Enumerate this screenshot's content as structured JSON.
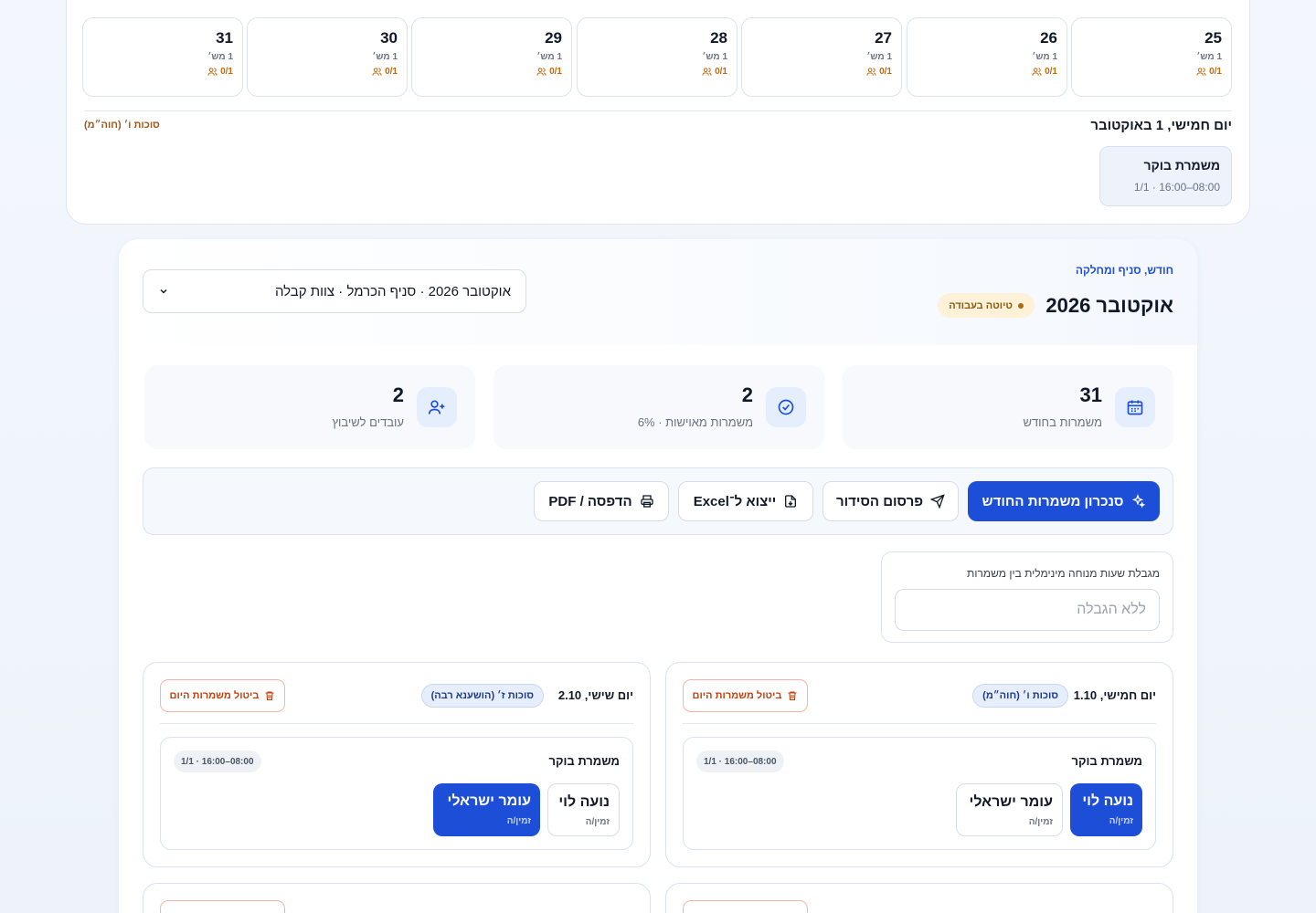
{
  "calendar": {
    "days": [
      {
        "num": "25",
        "count": "1 מש׳",
        "staff": "0/1"
      },
      {
        "num": "26",
        "count": "1 מש׳",
        "staff": "0/1"
      },
      {
        "num": "27",
        "count": "1 מש׳",
        "staff": "0/1"
      },
      {
        "num": "28",
        "count": "1 מש׳",
        "staff": "0/1"
      },
      {
        "num": "29",
        "count": "1 מש׳",
        "staff": "0/1"
      },
      {
        "num": "30",
        "count": "1 מש׳",
        "staff": "0/1"
      },
      {
        "num": "31",
        "count": "1 מש׳",
        "staff": "0/1"
      }
    ],
    "selected": {
      "date": "יום חמישי, 1 באוקטובר",
      "holiday": "סוכות ו׳ (חוה״מ)",
      "shift_name": "משמרת בוקר",
      "shift_meta": "08:00–16:00 · 1/1"
    }
  },
  "header": {
    "eyebrow": "חודש, סניף ומחלקה",
    "title": "אוקטובר 2026",
    "status": "טיוטה בעבודה",
    "period_select": "אוקטובר 2026 · סניף הכרמל · צוות קבלה"
  },
  "stats": [
    {
      "value": "31",
      "label": "משמרות בחודש",
      "icon": "calendar-icon"
    },
    {
      "value": "2",
      "label": "משמרות מאוישות · 6%",
      "icon": "check-circle-icon"
    },
    {
      "value": "2",
      "label": "עובדים לשיבוץ",
      "icon": "user-plus-icon"
    }
  ],
  "toolbar": {
    "sync": "סנכרון משמרות החודש",
    "publish": "פרסום הסידור",
    "export": "ייצוא ל־Excel",
    "print": "הדפסה / PDF"
  },
  "rest": {
    "label": "מגבלת שעות מנוחה מינימלית בין משמרות",
    "placeholder": "ללא הגבלה"
  },
  "days": [
    {
      "title": "יום חמישי, 1.10",
      "holiday": "סוכות ו׳ (חוה״מ)",
      "cancel": "ביטול משמרות היום",
      "shift_name": "משמרת בוקר",
      "shift_time": "08:00–16:00 · 1/1",
      "employees": [
        {
          "name": "נועה לוי",
          "status": "זמין/ה",
          "selected": true
        },
        {
          "name": "עומר ישראלי",
          "status": "זמין/ה",
          "selected": false
        }
      ]
    },
    {
      "title": "יום שישי, 2.10",
      "holiday": "סוכות ז׳ (הושענא רבה)",
      "cancel": "ביטול משמרות היום",
      "shift_name": "משמרת בוקר",
      "shift_time": "08:00–16:00 · 1/1",
      "employees": [
        {
          "name": "נועה לוי",
          "status": "זמין/ה",
          "selected": false
        },
        {
          "name": "עומר ישראלי",
          "status": "זמין/ה",
          "selected": true
        }
      ]
    }
  ],
  "colors": {
    "primary": "#1d4ed8",
    "warning": "#c2690f",
    "danger": "#c2410c"
  }
}
